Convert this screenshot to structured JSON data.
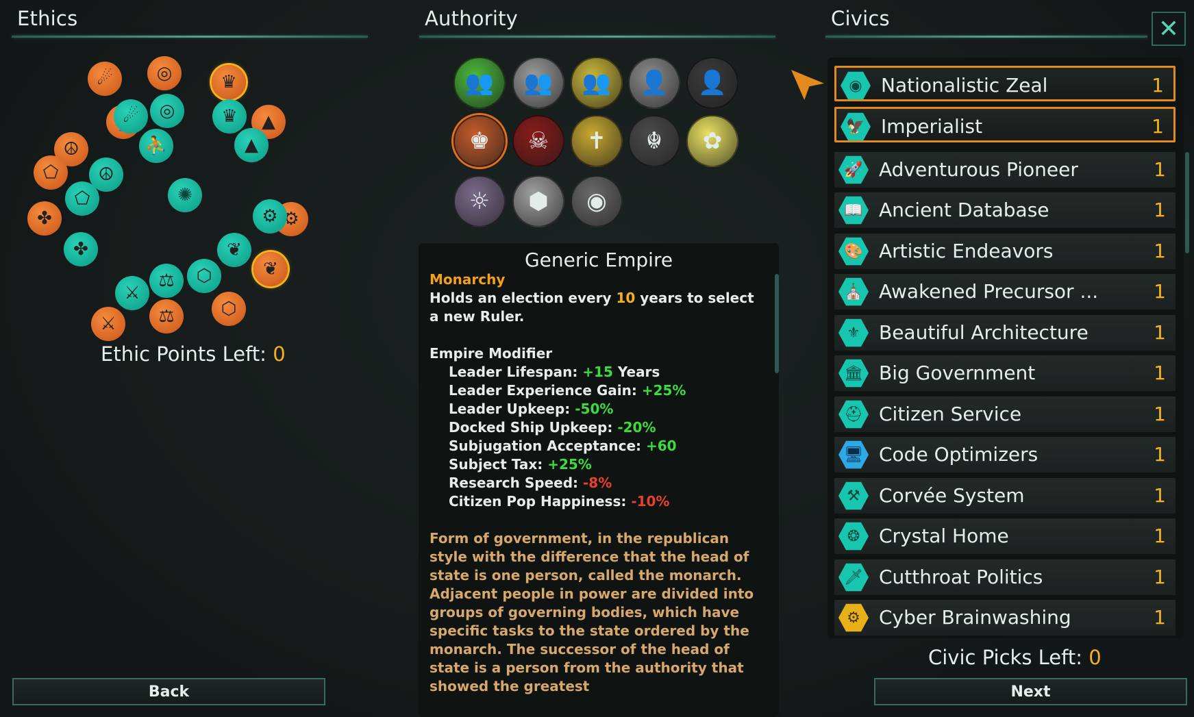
{
  "headers": {
    "ethics": "Ethics",
    "authority": "Authority",
    "civics": "Civics"
  },
  "ethics": {
    "points_label": "Ethic Points Left:",
    "points_value": "0",
    "icons": [
      {
        "name": "ethic-gestalt-consciousness-icon",
        "glyph": "✺"
      },
      {
        "name": "ethic-fanatic-spiritualist-icon",
        "glyph": "⛹"
      },
      {
        "name": "ethic-spiritualist-icon",
        "glyph": "⛹"
      },
      {
        "name": "ethic-fanatic-pacifist-icon",
        "glyph": "☮"
      },
      {
        "name": "ethic-pacifist-icon",
        "glyph": "☮"
      },
      {
        "name": "ethic-fanatic-militarist-icon",
        "glyph": "⚔"
      },
      {
        "name": "ethic-militarist-icon",
        "glyph": "⚔"
      },
      {
        "name": "ethic-fanatic-authoritarian-icon",
        "glyph": "♛"
      },
      {
        "name": "ethic-authoritarian-icon",
        "glyph": "♛"
      },
      {
        "name": "ethic-fanatic-egalitarian-icon",
        "glyph": "⚖"
      },
      {
        "name": "ethic-egalitarian-icon",
        "glyph": "⚖"
      },
      {
        "name": "ethic-fanatic-xenophile-icon",
        "glyph": "⬠"
      },
      {
        "name": "ethic-xenophile-icon",
        "glyph": "⬠"
      },
      {
        "name": "ethic-fanatic-xenophobe-icon",
        "glyph": "▲"
      },
      {
        "name": "ethic-xenophobe-icon",
        "glyph": "▲"
      },
      {
        "name": "ethic-fanatic-materialist-icon",
        "glyph": "⚙"
      },
      {
        "name": "ethic-materialist-icon",
        "glyph": "⚙"
      },
      {
        "name": "ethic-fanatic-gestalt-icon",
        "glyph": "⬡"
      },
      {
        "name": "ethic-gestalt-icon",
        "glyph": "⬡"
      },
      {
        "name": "ethic-fanatic-tree-icon",
        "glyph": "❦"
      },
      {
        "name": "ethic-tree-icon",
        "glyph": "❦"
      },
      {
        "name": "ethic-fanatic-torch-icon",
        "glyph": "☄"
      },
      {
        "name": "ethic-torch-icon",
        "glyph": "☄"
      },
      {
        "name": "ethic-fanatic-circle-icon",
        "glyph": "◎"
      },
      {
        "name": "ethic-circle-icon",
        "glyph": "◎"
      },
      {
        "name": "ethic-fanatic-triad-icon",
        "glyph": "✤"
      },
      {
        "name": "ethic-triad-icon",
        "glyph": "✤"
      }
    ]
  },
  "authority": {
    "icons": [
      {
        "name": "authority-democratic-icon",
        "glyph": "👥",
        "color": "#4ab83c"
      },
      {
        "name": "authority-oligarchic-icon",
        "glyph": "👥",
        "color": "#9a9a9a"
      },
      {
        "name": "authority-dictatorial-icon",
        "glyph": "👥",
        "color": "#c8b43a"
      },
      {
        "name": "authority-imperial-icon",
        "glyph": "👤",
        "color": "#8a8a8a"
      },
      {
        "name": "authority-corporate-icon",
        "glyph": "👤",
        "color": "#3a3a3a"
      },
      {
        "name": "authority-monarchy-icon",
        "glyph": "♚",
        "color": "#c45a2a"
      },
      {
        "name": "authority-death-icon",
        "glyph": "☠",
        "color": "#8a1a1a"
      },
      {
        "name": "authority-theocracy-icon",
        "glyph": "✝",
        "color": "#c8a830"
      },
      {
        "name": "authority-cult-icon",
        "glyph": "☬",
        "color": "#4a4a4a"
      },
      {
        "name": "authority-frogs-icon",
        "glyph": "✿",
        "color": "#e8e060"
      },
      {
        "name": "authority-council-icon",
        "glyph": "☼",
        "color": "#7a6a8a"
      },
      {
        "name": "authority-hive-icon",
        "glyph": "⬢",
        "color": "#a0a0a0"
      },
      {
        "name": "authority-machine-icon",
        "glyph": "◉",
        "color": "#6a6a6a"
      }
    ],
    "panel_title": "Generic Empire",
    "name": "Monarchy",
    "desc_pre": "Holds an election every ",
    "desc_years": "10",
    "desc_post": " years to select a new Ruler.",
    "modifier_title": "Empire Modifier",
    "modifiers": [
      {
        "label": "Leader Lifespan: ",
        "value": "+15",
        "suffix": " Years",
        "color": "g"
      },
      {
        "label": "Leader Experience Gain: ",
        "value": "+25%",
        "suffix": "",
        "color": "g"
      },
      {
        "label": "Leader Upkeep: ",
        "value": "-50%",
        "suffix": "",
        "color": "g"
      },
      {
        "label": "Docked Ship Upkeep: ",
        "value": "-20%",
        "suffix": "",
        "color": "g"
      },
      {
        "label": "Subjugation Acceptance: ",
        "value": "+60",
        "suffix": "",
        "color": "g"
      },
      {
        "label": "Subject Tax: ",
        "value": "+25%",
        "suffix": "",
        "color": "g"
      },
      {
        "label": "Research Speed: ",
        "value": "-8%",
        "suffix": "",
        "color": "r"
      },
      {
        "label": "Citizen Pop Happiness: ",
        "value": "-10%",
        "suffix": "",
        "color": "r"
      }
    ],
    "lore": "Form of government, in the republican style with the difference that the head of state is one person, called the monarch. Adjacent people in power are divided into groups of governing bodies, which have specific tasks to the state ordered by the monarch. The successor of the head of state is a person from the authority that showed the greatest"
  },
  "civics": {
    "items": [
      {
        "name": "Nationalistic Zeal",
        "cost": "1",
        "icon": "◉",
        "selected": true
      },
      {
        "name": "Imperialist",
        "cost": "1",
        "icon": "🦅",
        "selected": true
      },
      {
        "name": "Adventurous Pioneer",
        "cost": "1",
        "icon": "🚀"
      },
      {
        "name": "Ancient Database",
        "cost": "1",
        "icon": "📖"
      },
      {
        "name": "Artistic Endeavors",
        "cost": "1",
        "icon": "🎨"
      },
      {
        "name": "Awakened Precursor  ...",
        "cost": "1",
        "icon": "⛪"
      },
      {
        "name": "Beautiful Architecture",
        "cost": "1",
        "icon": "⚜"
      },
      {
        "name": "Big Government",
        "cost": "1",
        "icon": "🏛"
      },
      {
        "name": "Citizen Service",
        "cost": "1",
        "icon": "⛑"
      },
      {
        "name": "Code Optimizers",
        "cost": "1",
        "icon": "🖥",
        "color": "blue"
      },
      {
        "name": "Corvée System",
        "cost": "1",
        "icon": "⚒"
      },
      {
        "name": "Crystal Home",
        "cost": "1",
        "icon": "❂"
      },
      {
        "name": "Cutthroat Politics",
        "cost": "1",
        "icon": "🗡"
      },
      {
        "name": "Cyber Brainwashing",
        "cost": "1",
        "icon": "⚙",
        "color": "gold"
      }
    ],
    "picks_label": "Civic Picks Left:",
    "picks_value": "0"
  },
  "buttons": {
    "back": "Back",
    "next": "Next",
    "close": "✕"
  }
}
